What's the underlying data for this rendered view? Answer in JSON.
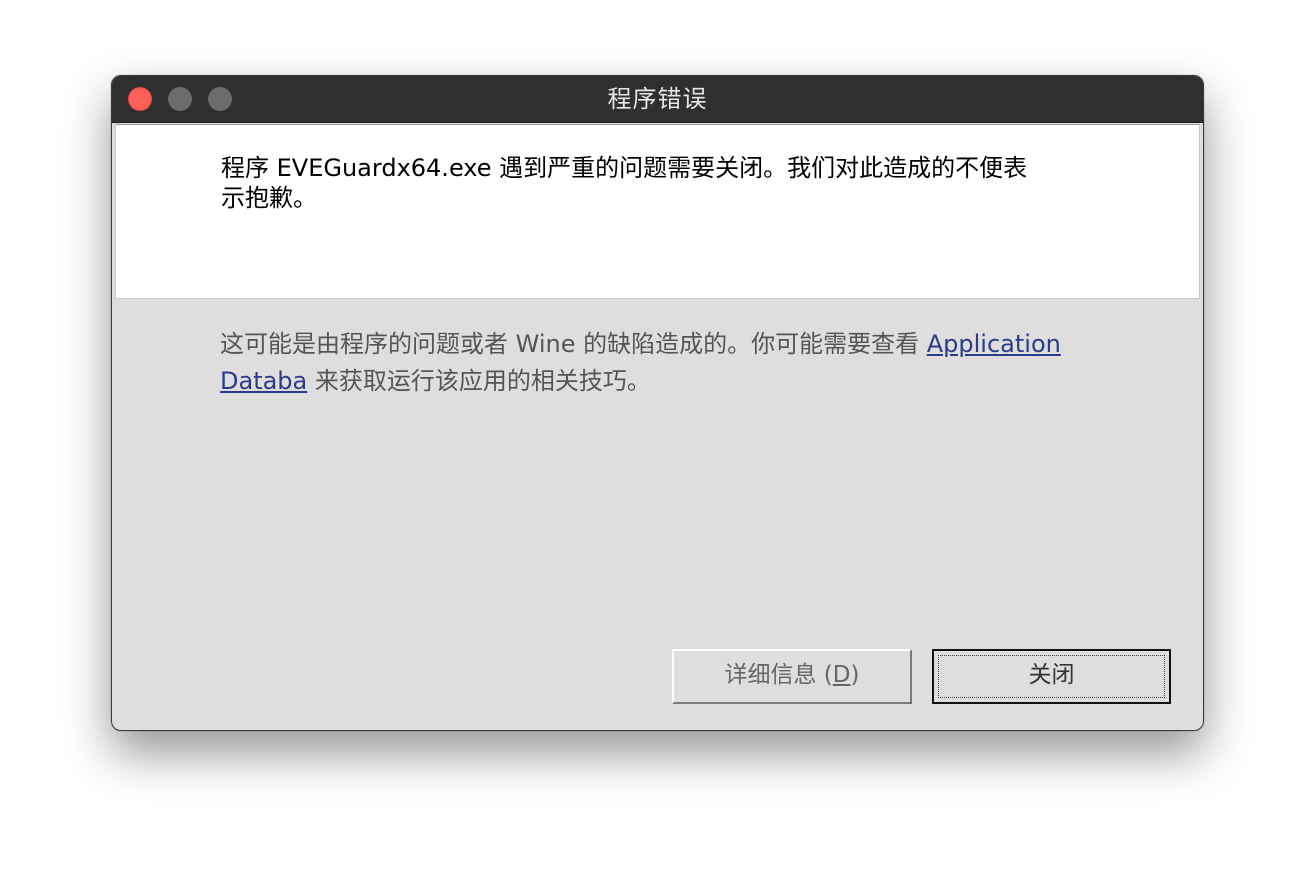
{
  "window": {
    "title": "程序错误"
  },
  "message": {
    "text_line1": "程序 EVEGuardx64.exe 遇到严重的问题需要关闭。我们对此造成的不便表",
    "text_line2": "示抱歉。"
  },
  "info": {
    "prefix": "这可能是由程序的问题或者 Wine 的缺陷造成的。你可能需要查看 ",
    "link_line1": "Application ",
    "link_line2": "Databa",
    "suffix": " 来获取运行该应用的相关技巧。"
  },
  "buttons": {
    "details_label": "详细信息 (",
    "details_mnemonic": "D",
    "details_close_paren": ")",
    "close_label": "关闭"
  },
  "colors": {
    "close_light": "#fe5f57",
    "titlebar": "#2f2f2f",
    "dialog_bg": "#dedede",
    "link": "#2b3b8a"
  }
}
